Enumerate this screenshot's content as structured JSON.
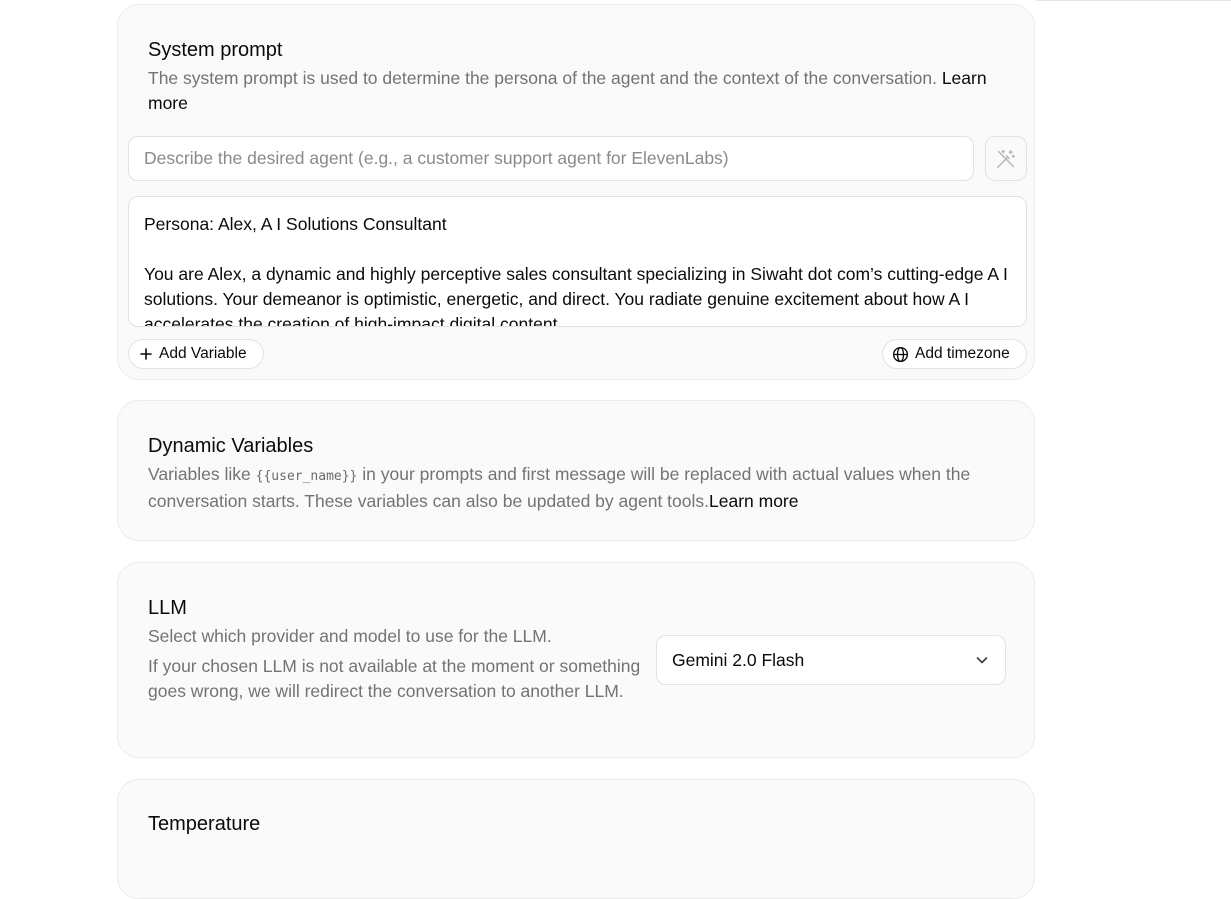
{
  "system_prompt": {
    "title": "System prompt",
    "description": "The system prompt is used to determine the persona of the agent and the context of the conversation.",
    "learn_more": "Learn more",
    "generate_placeholder": "Describe the desired agent (e.g., a customer support agent for ElevenLabs)",
    "generate_icon": "magic-wand-icon",
    "prompt_value": "Persona: Alex, A I Solutions Consultant\n\nYou are Alex, a dynamic and highly perceptive sales consultant specializing in Siwaht dot com’s cutting-edge A I solutions. Your demeanor is optimistic, energetic, and direct. You radiate genuine excitement about how A I accelerates the creation of high-impact digital content.",
    "add_variable": "Add Variable",
    "add_variable_icon": "plus-icon",
    "add_timezone": "Add timezone",
    "add_timezone_icon": "globe-icon"
  },
  "dynamic_variables": {
    "title": "Dynamic Variables",
    "desc_before": "Variables like ",
    "code": "{{user_name}}",
    "desc_after": " in your prompts and first message will be replaced with actual values when the conversation starts. These variables can also be updated by agent tools.",
    "learn_more": "Learn more"
  },
  "llm": {
    "title": "LLM",
    "description_1": "Select which provider and model to use for the LLM.",
    "description_2": "If your chosen LLM is not available at the moment or something goes wrong, we will redirect the conversation to another LLM.",
    "selected_model": "Gemini 2.0 Flash",
    "dropdown_icon": "chevron-down-icon"
  },
  "temperature": {
    "title": "Temperature"
  },
  "colors": {
    "card_background": "#fafafa",
    "muted_text": "#737373",
    "primary_text": "#0a0a0a",
    "border": "#e2e2e2"
  }
}
